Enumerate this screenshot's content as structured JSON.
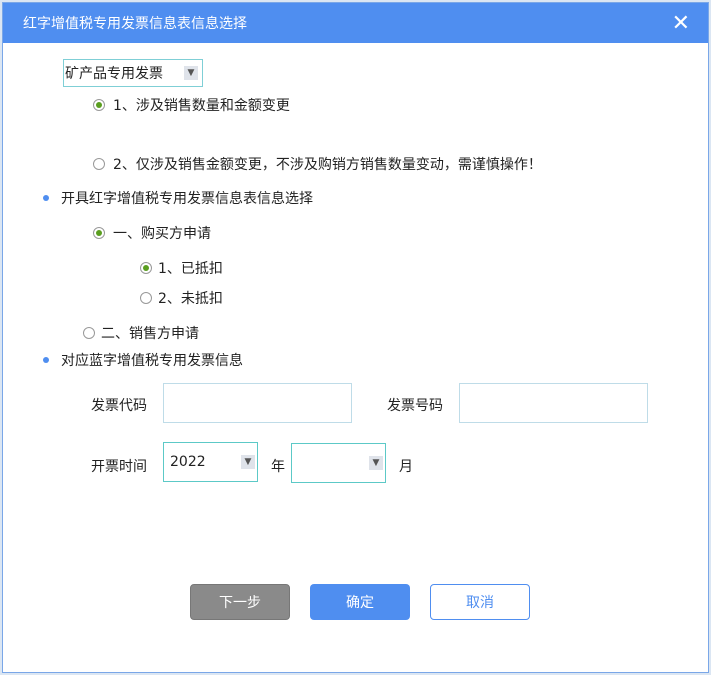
{
  "title": "红字增值税专用发票信息表信息选择",
  "invoice_type": "矿产品专用发票",
  "options": {
    "opt1": "1、涉及销售数量和金额变更",
    "opt2": "2、仅涉及销售金额变更，不涉及购销方销售数量变动，需谨慎操作！"
  },
  "section1": "开具红字增值税专用发票信息表信息选择",
  "buyer": "一、购买方申请",
  "deducted": "1、已抵扣",
  "not_deducted": "2、未抵扣",
  "seller": "二、销售方申请",
  "section2": "对应蓝字增值税专用发票信息",
  "form": {
    "code_label": "发票代码",
    "number_label": "发票号码",
    "code_value": "",
    "number_value": "",
    "date_label": "开票时间",
    "year": "2022",
    "year_unit": "年",
    "month": "",
    "month_unit": "月"
  },
  "buttons": {
    "next": "下一步",
    "ok": "确定",
    "cancel": "取消"
  }
}
